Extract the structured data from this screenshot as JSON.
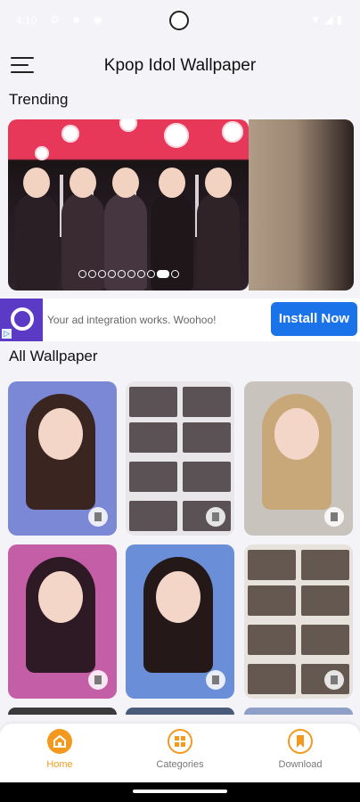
{
  "status_bar": {
    "time": "4:10",
    "left_icons": "⚙ ■ ◉",
    "right_icons": "▼◢▮"
  },
  "app_bar": {
    "title": "Kpop Idol Wallpaper",
    "menu_icon": "hamburger-menu-icon"
  },
  "sections": {
    "trending": "Trending",
    "all_wallpaper": "All Wallpaper"
  },
  "carousel": {
    "slide_count": 10,
    "active_index": 8
  },
  "ad": {
    "text": "Your ad integration works. Woohoo!",
    "button": "Install Now",
    "brand_color": "#5b3ac6",
    "button_color": "#1a73e8"
  },
  "wallpapers": [
    {
      "id": "wallpaper-1",
      "bg": "#7b88d6",
      "hair": "#3b2520"
    },
    {
      "id": "wallpaper-2",
      "bg": "#e9e6ea",
      "hair": "#2a2022"
    },
    {
      "id": "wallpaper-3",
      "bg": "#c9c3bd",
      "hair": "#c8a878"
    },
    {
      "id": "wallpaper-4",
      "bg": "#c45ea6",
      "hair": "#2d1a24"
    },
    {
      "id": "wallpaper-5",
      "bg": "#6a8fd8",
      "hair": "#241818"
    },
    {
      "id": "wallpaper-6",
      "bg": "#e8e2dc",
      "hair": "#3a2a22"
    }
  ],
  "bottom_nav": [
    {
      "label": "Home",
      "icon": "home-icon",
      "active": true
    },
    {
      "label": "Categories",
      "icon": "grid-icon",
      "active": false
    },
    {
      "label": "Download",
      "icon": "bookmark-icon",
      "active": false
    }
  ],
  "colors": {
    "active": "#f39a1e",
    "inactive_text": "#777777",
    "icon_ring": "#f39a1e"
  }
}
